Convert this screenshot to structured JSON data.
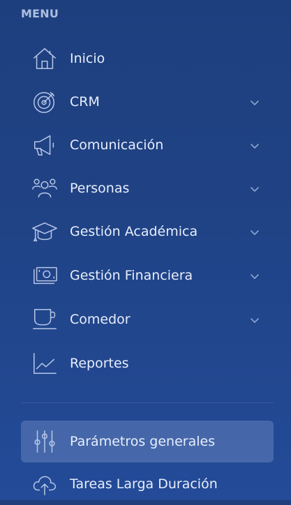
{
  "sidebar": {
    "heading": "MENU",
    "items": [
      {
        "label": "Inicio",
        "icon": "home-icon",
        "has_submenu": false
      },
      {
        "label": "CRM",
        "icon": "target-icon",
        "has_submenu": true
      },
      {
        "label": "Comunicación",
        "icon": "megaphone-icon",
        "has_submenu": true
      },
      {
        "label": "Personas",
        "icon": "users-icon",
        "has_submenu": true
      },
      {
        "label": "Gestión Académica",
        "icon": "graduation-cap-icon",
        "has_submenu": true
      },
      {
        "label": "Gestión Financiera",
        "icon": "money-icon",
        "has_submenu": true
      },
      {
        "label": "Comedor",
        "icon": "cup-icon",
        "has_submenu": true
      },
      {
        "label": "Reportes",
        "icon": "line-chart-icon",
        "has_submenu": false
      }
    ],
    "secondary_items": [
      {
        "label": "Parámetros generales",
        "icon": "sliders-icon",
        "active": true
      },
      {
        "label": "Tareas Larga Duración",
        "icon": "cloud-upload-icon",
        "active": false
      }
    ]
  },
  "colors": {
    "background_top": "#1e3f7e",
    "background_bottom": "#234b98",
    "text": "#e8eefb",
    "icon": "#b6c5e6",
    "active_background": "#5c77b3"
  }
}
